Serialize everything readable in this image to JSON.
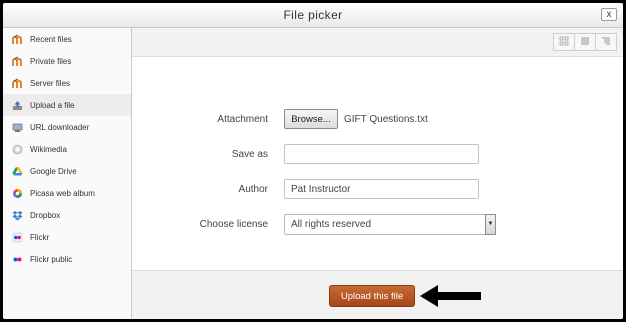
{
  "window": {
    "title": "File picker",
    "close_label": "x"
  },
  "sidebar": {
    "items": [
      {
        "label": "Recent files",
        "icon": "moodle-icon"
      },
      {
        "label": "Private files",
        "icon": "moodle-icon"
      },
      {
        "label": "Server files",
        "icon": "moodle-icon"
      },
      {
        "label": "Upload a file",
        "icon": "upload-icon",
        "active": true
      },
      {
        "label": "URL downloader",
        "icon": "url-icon"
      },
      {
        "label": "Wikimedia",
        "icon": "wikimedia-icon"
      },
      {
        "label": "Google Drive",
        "icon": "google-drive-icon"
      },
      {
        "label": "Picasa web album",
        "icon": "picasa-icon"
      },
      {
        "label": "Dropbox",
        "icon": "dropbox-icon"
      },
      {
        "label": "Flickr",
        "icon": "flickr-icon"
      },
      {
        "label": "Flickr public",
        "icon": "flickr-public-icon"
      }
    ]
  },
  "toolbar": {
    "views": [
      "icon-view-icon",
      "list-view-icon",
      "tree-view-icon"
    ]
  },
  "form": {
    "attachment_label": "Attachment",
    "browse_label": "Browse...",
    "selected_file": "GIFT Questions.txt",
    "saveas_label": "Save as",
    "saveas_value": "",
    "author_label": "Author",
    "author_value": "Pat Instructor",
    "license_label": "Choose license",
    "license_value": "All rights reserved"
  },
  "footer": {
    "upload_label": "Upload this file"
  },
  "colors": {
    "upload_button": "#b5562a",
    "arrow": "#000000"
  }
}
